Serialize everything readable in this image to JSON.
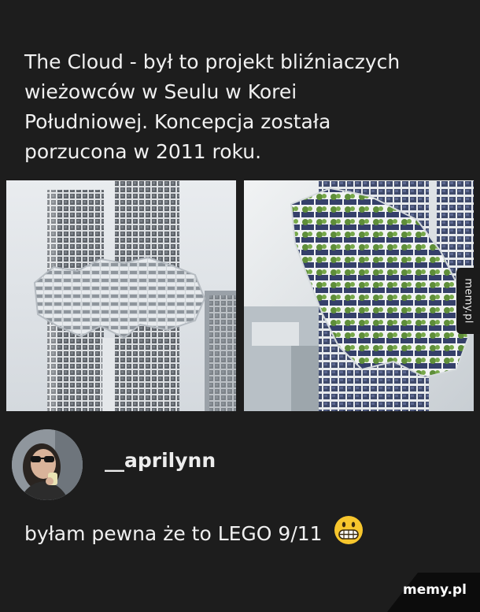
{
  "post": {
    "caption": "The Cloud - był to projekt bliźniaczych\nwieżowców w Seulu w Korei\nPołudniowej. Koncepcja została\nporzucona w 2011 roku."
  },
  "watermark": {
    "side": "memy.pl",
    "footer": "memy.pl"
  },
  "comment": {
    "username": "__aprilynn",
    "text": "byłam pewna że to LEGO 9/11",
    "emoji": "grimacing-face-emoji"
  }
}
